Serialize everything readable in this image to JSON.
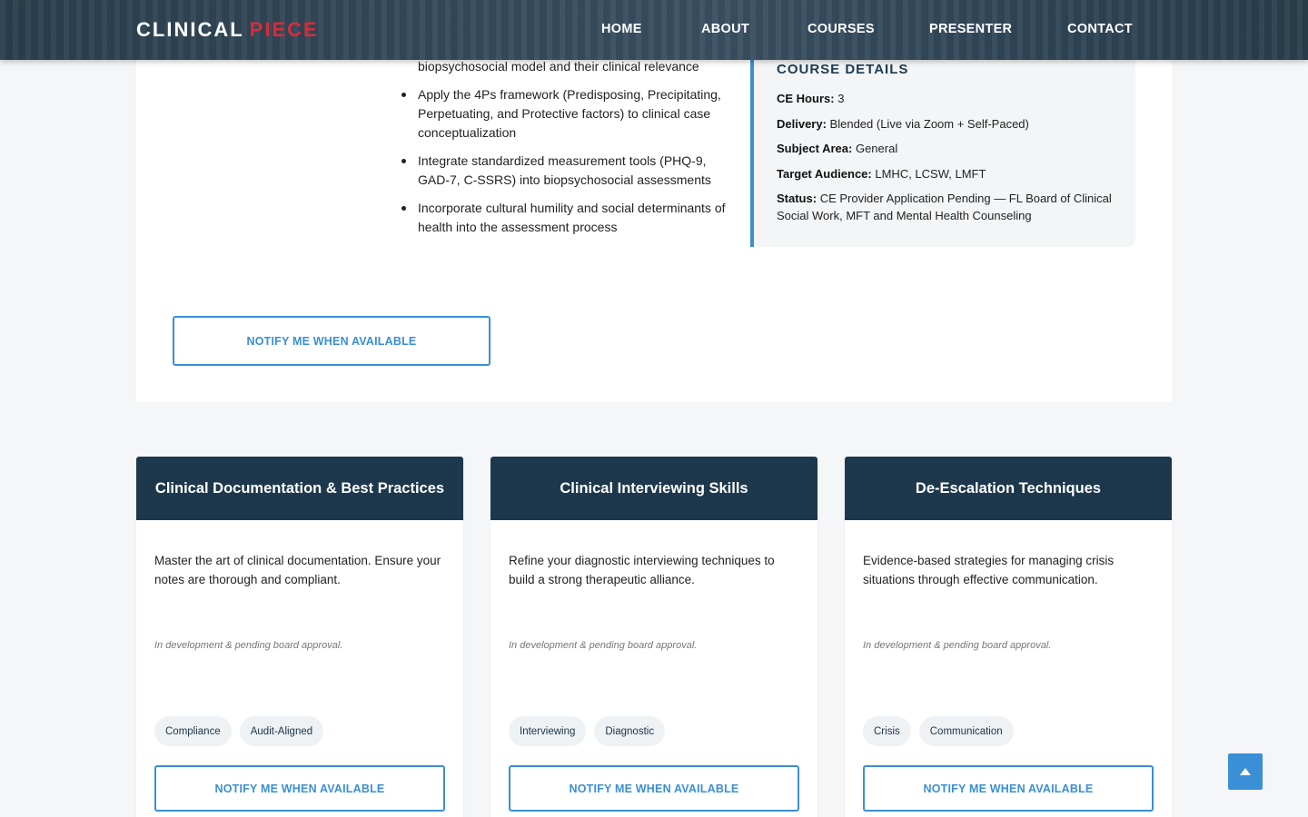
{
  "header": {
    "logo_main": "CLINICAL",
    "logo_accent": "PIECE",
    "nav": [
      "HOME",
      "ABOUT",
      "COURSES",
      "PRESENTER",
      "CONTACT"
    ]
  },
  "course": {
    "objectives": [
      "biopsychosocial model and their clinical relevance",
      "Apply the 4Ps framework (Predisposing, Precipitating, Perpetuating, and Protective factors) to clinical case conceptualization",
      "Integrate standardized measurement tools (PHQ-9, GAD-7, C-SSRS) into biopsychosocial assessments",
      "Incorporate cultural humility and social determinants of health into the assessment process"
    ],
    "details": {
      "title": "COURSE DETAILS",
      "rows": [
        {
          "label": "CE Hours:",
          "value": "3"
        },
        {
          "label": "Delivery:",
          "value": "Blended (Live via Zoom + Self-Paced)"
        },
        {
          "label": "Subject Area:",
          "value": "General"
        },
        {
          "label": "Target Audience:",
          "value": "LMHC, LCSW, LMFT"
        },
        {
          "label": "Status:",
          "value": "CE Provider Application Pending — FL Board of Clinical Social Work, MFT and Mental Health Counseling"
        }
      ]
    },
    "notify_label": "NOTIFY ME WHEN AVAILABLE"
  },
  "cards": [
    {
      "title": "Clinical Documentation & Best Practices",
      "description": "Master the art of clinical documentation. Ensure your notes are thorough and compliant.",
      "note": "In development & pending board approval.",
      "tags": [
        "Compliance",
        "Audit-Aligned"
      ],
      "button": "NOTIFY ME WHEN AVAILABLE"
    },
    {
      "title": "Clinical Interviewing Skills",
      "description": "Refine your diagnostic interviewing techniques to build a strong therapeutic alliance.",
      "note": "In development & pending board approval.",
      "tags": [
        "Interviewing",
        "Diagnostic"
      ],
      "button": "NOTIFY ME WHEN AVAILABLE"
    },
    {
      "title": "De-Escalation Techniques",
      "description": "Evidence-based strategies for managing crisis situations through effective communication.",
      "note": "In development & pending board approval.",
      "tags": [
        "Crisis",
        "Communication"
      ],
      "button": "NOTIFY ME WHEN AVAILABLE"
    }
  ],
  "colors": {
    "header_bg": "#33495a",
    "accent_red": "#d62c3a",
    "accent_blue": "#3a8fd6",
    "card_head": "#1d384c"
  },
  "icons": {
    "back_to_top": "caret-up-icon"
  }
}
